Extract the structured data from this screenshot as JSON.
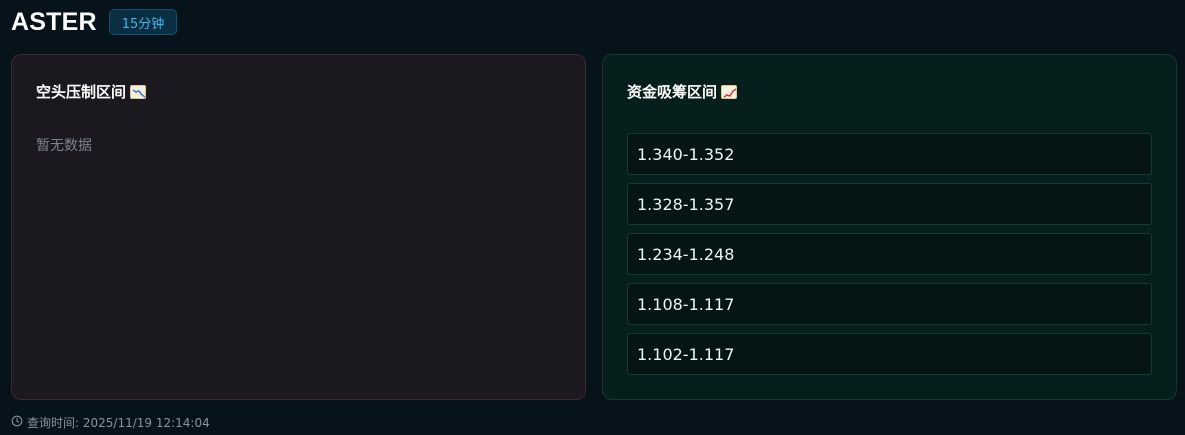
{
  "header": {
    "title": "ASTER",
    "timeframe": "15分钟"
  },
  "panels": {
    "bear": {
      "title": "空头压制区间",
      "icon": "chart-decreasing-icon",
      "empty_text": "暂无数据",
      "items": []
    },
    "bull": {
      "title": "资金吸筹区间",
      "icon": "chart-increasing-icon",
      "items": [
        "1.340-1.352",
        "1.328-1.357",
        "1.234-1.248",
        "1.108-1.117",
        "1.102-1.117"
      ]
    }
  },
  "footer": {
    "query_time": "查询时间: 2025/11/19 12:14:04"
  },
  "colors": {
    "background": "#07131b",
    "bear_panel": "#1b1820",
    "bull_panel": "#071f1c",
    "badge_text": "#3cb6e8"
  }
}
